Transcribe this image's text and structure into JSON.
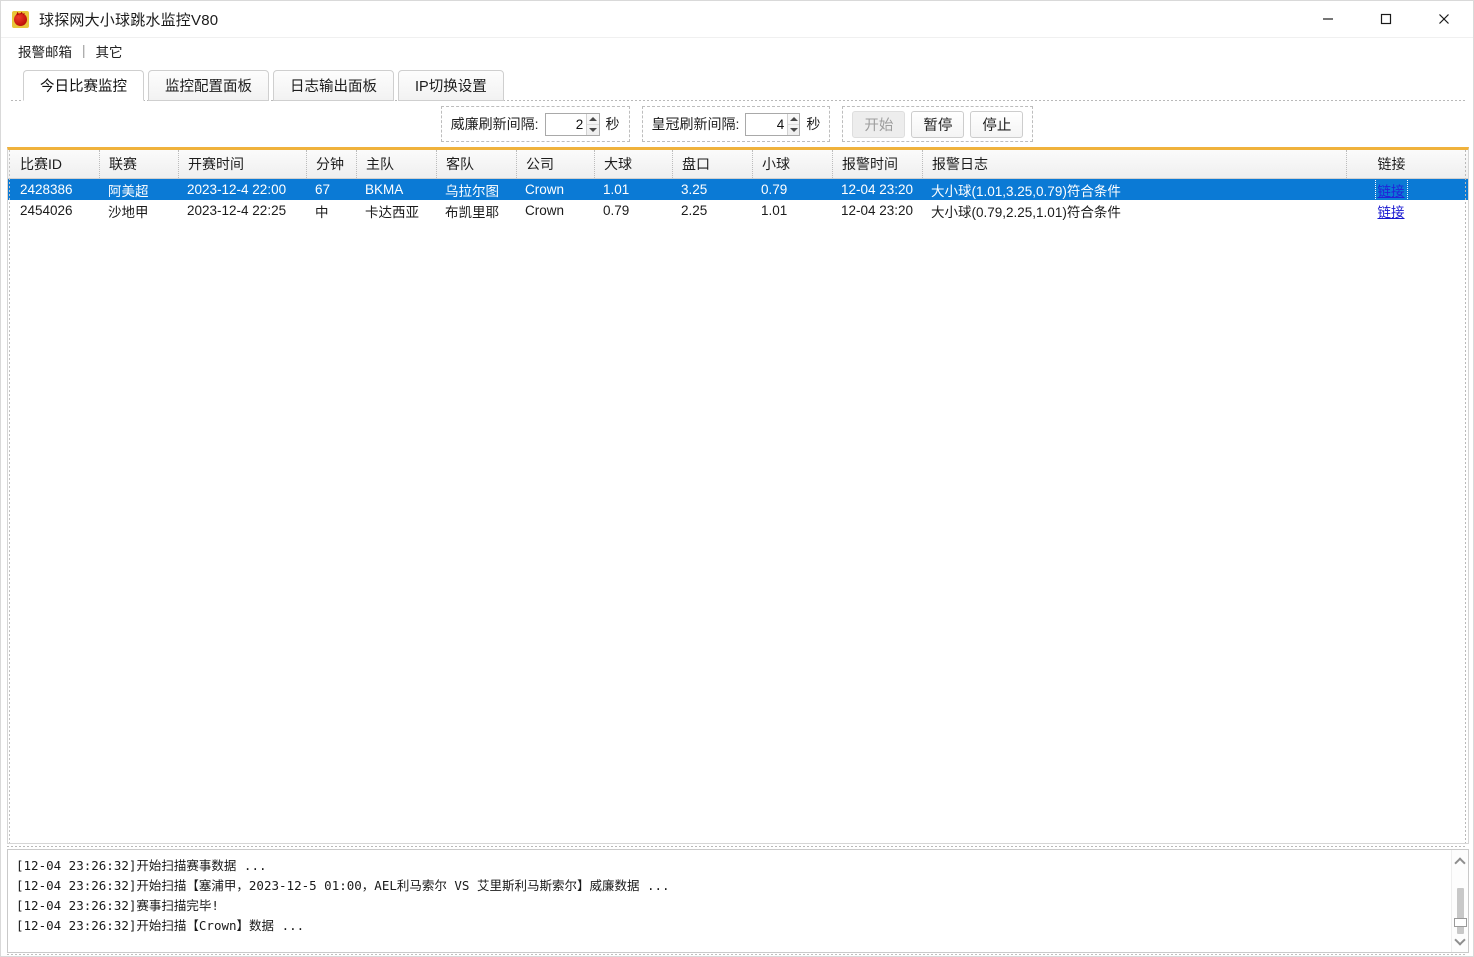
{
  "window": {
    "title": "球探网大小球跳水监控V80",
    "icon": "devil-icon",
    "minimize": "minimize-icon",
    "maximize": "maximize-icon",
    "close": "close-icon"
  },
  "menubar": {
    "items": [
      {
        "label": "报警邮箱"
      },
      {
        "label": "其它"
      }
    ],
    "separator": "|"
  },
  "tabs": [
    {
      "label": "今日比赛监控",
      "active": true
    },
    {
      "label": "监控配置面板",
      "active": false
    },
    {
      "label": "日志输出面板",
      "active": false
    },
    {
      "label": "IP切换设置",
      "active": false
    }
  ],
  "toolbar": {
    "william": {
      "label": "威廉刷新间隔:",
      "value": "2",
      "unit": "秒"
    },
    "crown": {
      "label": "皇冠刷新间隔:",
      "value": "4",
      "unit": "秒"
    },
    "buttons": [
      {
        "label": "开始",
        "disabled": true
      },
      {
        "label": "暂停",
        "disabled": false
      },
      {
        "label": "停止",
        "disabled": false
      }
    ]
  },
  "grid": {
    "columns": [
      {
        "key": "id",
        "label": "比赛ID"
      },
      {
        "key": "lg",
        "label": "联赛"
      },
      {
        "key": "time",
        "label": "开赛时间"
      },
      {
        "key": "min",
        "label": "分钟"
      },
      {
        "key": "home",
        "label": "主队"
      },
      {
        "key": "away",
        "label": "客队"
      },
      {
        "key": "comp",
        "label": "公司"
      },
      {
        "key": "over",
        "label": "大球"
      },
      {
        "key": "hand",
        "label": "盘口"
      },
      {
        "key": "under",
        "label": "小球"
      },
      {
        "key": "atime",
        "label": "报警时间"
      },
      {
        "key": "alog",
        "label": "报警日志"
      },
      {
        "key": "link",
        "label": "链接"
      }
    ],
    "rows": [
      {
        "id": "2428386",
        "lg": "阿美超",
        "time": "2023-12-4 22:00",
        "min": "67",
        "home": "BKMA",
        "away": "乌拉尔图",
        "comp": "Crown",
        "over": "1.01",
        "hand": "3.25",
        "under": "0.79",
        "atime": "12-04 23:20",
        "alog": "大小球(1.01,3.25,0.79)符合条件",
        "link": "链接",
        "selected": true
      },
      {
        "id": "2454026",
        "lg": "沙地甲",
        "time": "2023-12-4 22:25",
        "min": "中",
        "home": "卡达西亚",
        "away": "布凯里耶",
        "comp": "Crown",
        "over": "0.79",
        "hand": "2.25",
        "under": "1.01",
        "atime": "12-04 23:20",
        "alog": "大小球(0.79,2.25,1.01)符合条件",
        "link": "链接",
        "selected": false
      }
    ]
  },
  "log": {
    "lines": [
      "[12-04 23:26:32]开始扫描赛事数据 ...",
      "[12-04 23:26:32]开始扫描【塞浦甲，2023-12-5 01:00，AEL利马索尔 VS 艾里斯利马斯索尔】威廉数据 ...",
      "[12-04 23:26:32]赛事扫描完毕!",
      "[12-04 23:26:32]开始扫描【Crown】数据 ..."
    ],
    "scroll_up": "scroll-up-icon",
    "scroll_down": "scroll-down-icon"
  },
  "colors": {
    "selection": "#0b7ad5",
    "accent_rule": "#f0b23c",
    "link": "#1616d0"
  }
}
